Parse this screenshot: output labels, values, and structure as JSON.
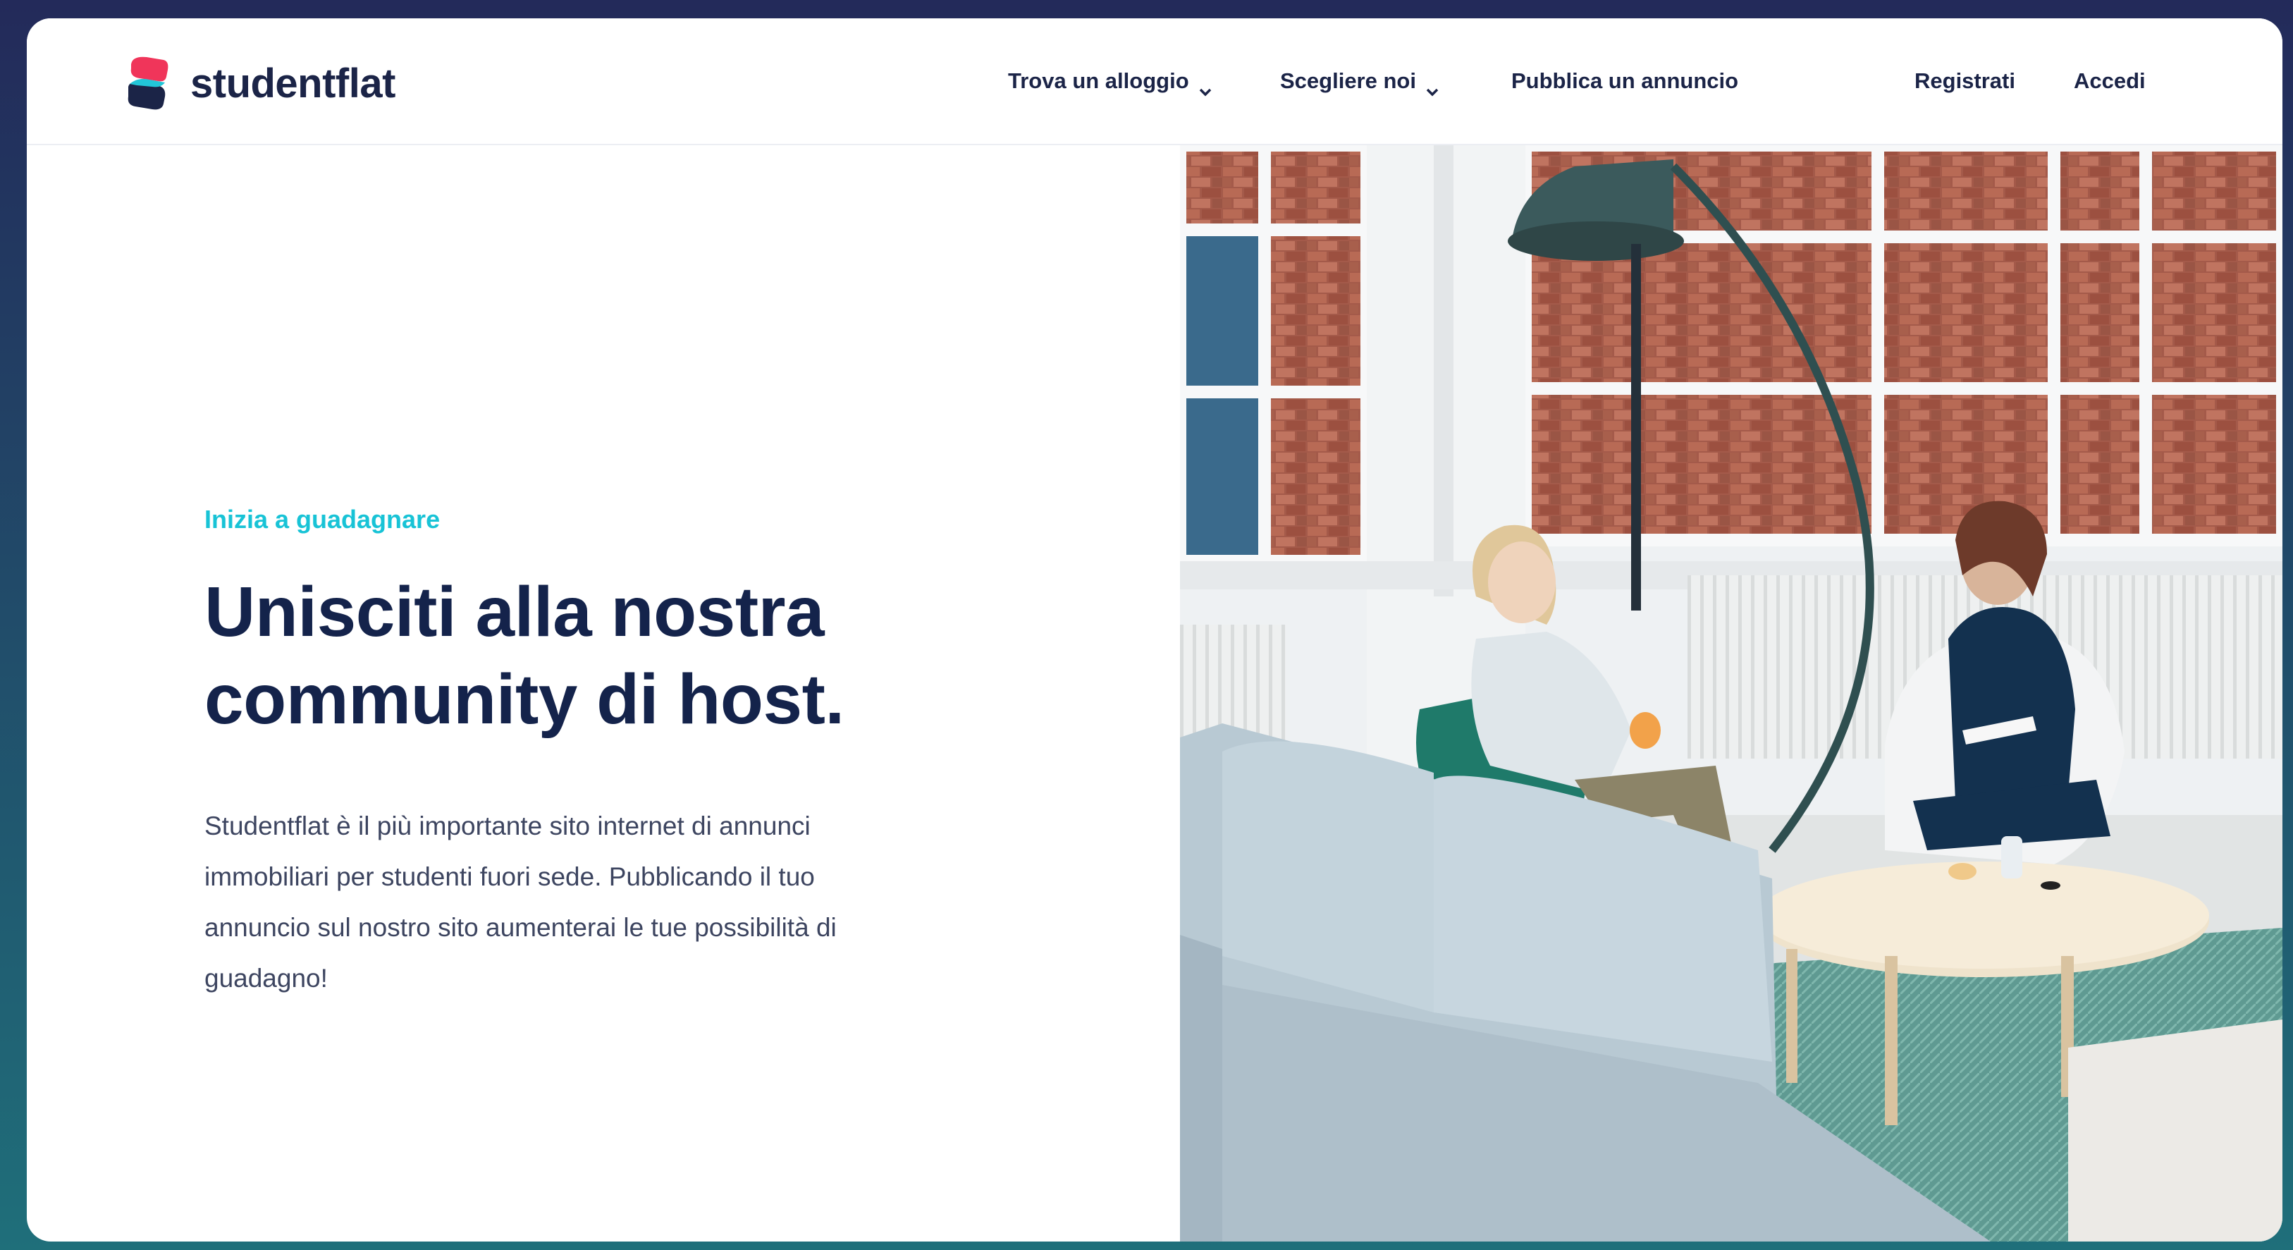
{
  "brand": {
    "name": "studentflat"
  },
  "nav": {
    "find_label": "Trova un alloggio",
    "choose_label": "Scegliere noi",
    "publish_label": "Pubblica un annuncio",
    "register_label": "Registrati",
    "login_label": "Accedi"
  },
  "hero": {
    "eyebrow": "Inizia a guadagnare",
    "headline_line1": "Unisciti alla nostra",
    "headline_line2": "community di host.",
    "body_line1": "Studentflat è il più importante sito internet di annunci",
    "body_line2": "immobiliari per studenti fuori sede. Pubblicando il tuo",
    "body_line3": "annuncio sul nostro sito aumenterai le tue possibilità di",
    "body_line4": "guadagno!"
  },
  "colors": {
    "accent": "#18c3d6",
    "brand_red": "#f0355a",
    "text_dark": "#14234b"
  },
  "icons": [
    "chevron-down-icon",
    "studentflat-logo"
  ]
}
